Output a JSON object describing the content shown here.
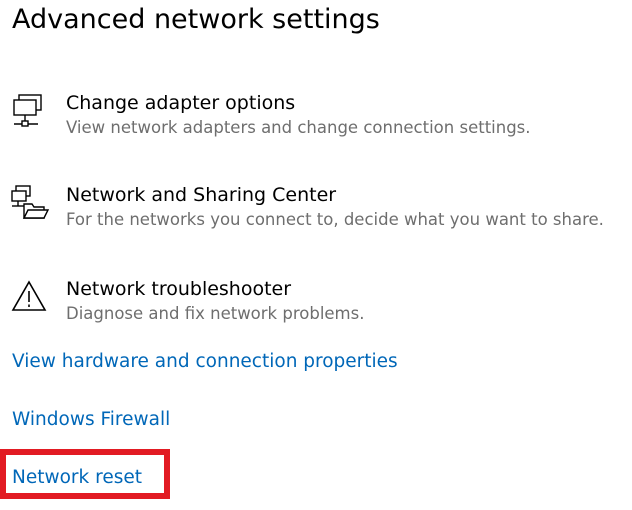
{
  "page": {
    "title": "Advanced network settings"
  },
  "settings": [
    {
      "icon": "network-adapter-icon",
      "title": "Change adapter options",
      "description": "View network adapters and change connection settings."
    },
    {
      "icon": "network-sharing-icon",
      "title": "Network and Sharing Center",
      "description": "For the networks you connect to, decide what you want to share."
    },
    {
      "icon": "warning-icon",
      "title": "Network troubleshooter",
      "description": "Diagnose and fix network problems."
    }
  ],
  "links": {
    "hardware_properties": "View hardware and connection properties",
    "windows_firewall": "Windows Firewall",
    "network_reset": "Network reset"
  },
  "colors": {
    "link": "#0067b8",
    "description_text": "#6e6e6e",
    "highlight_border": "#e21b23"
  }
}
